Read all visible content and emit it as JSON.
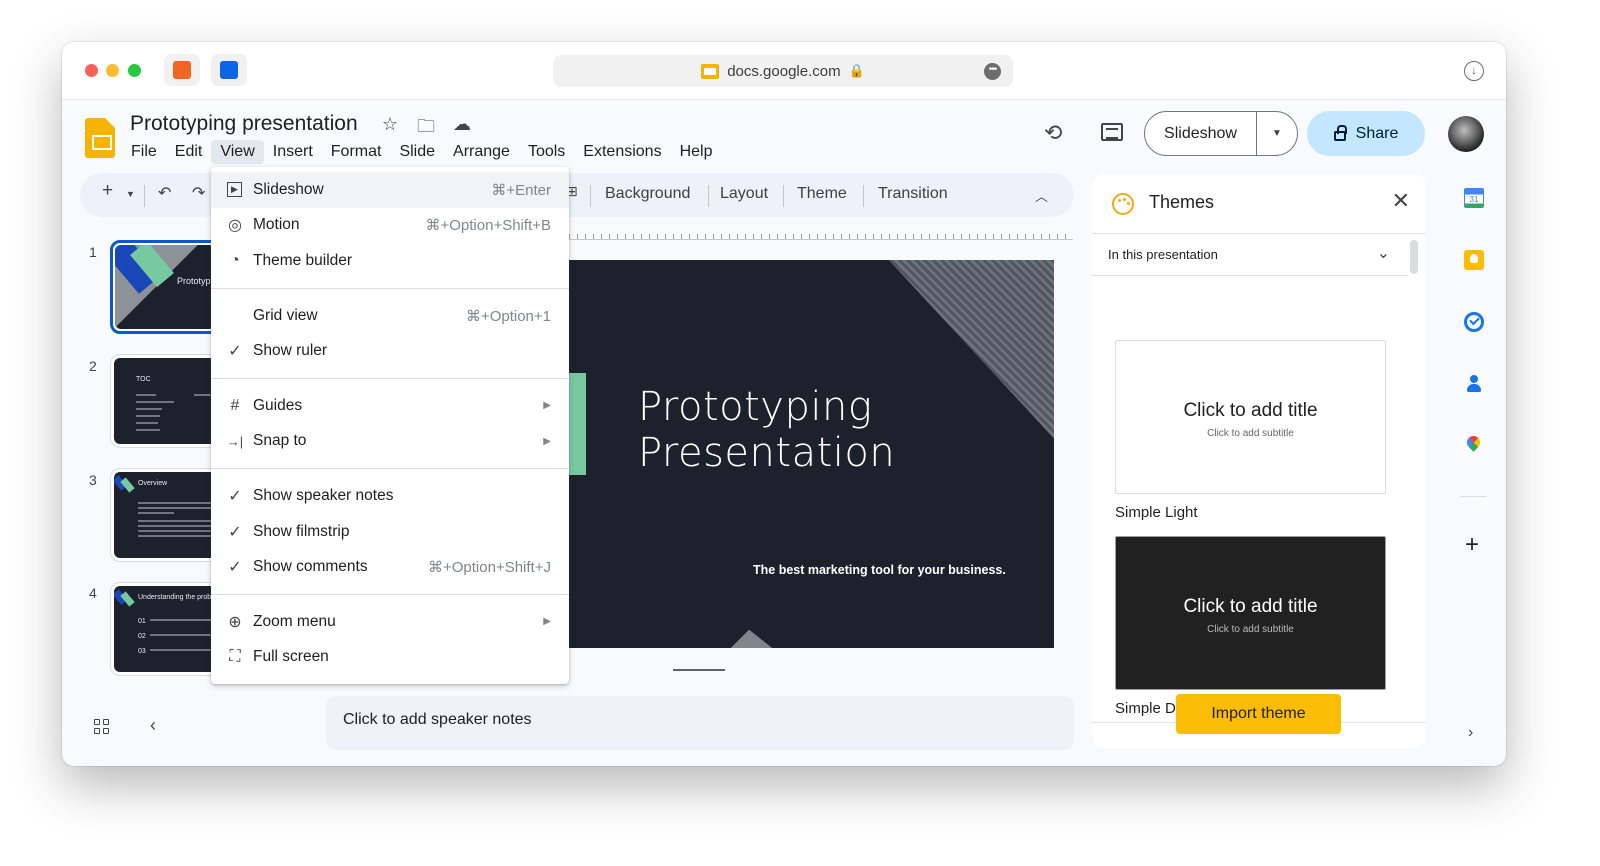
{
  "browser": {
    "url": "docs.google.com",
    "extensions": [
      "html-extension",
      "trello-extension"
    ]
  },
  "header": {
    "doc_title": "Prototyping presentation",
    "menu": [
      "File",
      "Edit",
      "View",
      "Insert",
      "Format",
      "Slide",
      "Arrange",
      "Tools",
      "Extensions",
      "Help"
    ],
    "active_menu": "View",
    "slideshow_label": "Slideshow",
    "share_label": "Share"
  },
  "toolbar": {
    "items": [
      "Background",
      "Layout",
      "Theme",
      "Transition"
    ]
  },
  "view_menu": {
    "groups": [
      [
        {
          "icon": "play-box-icon",
          "glyph": "▶",
          "label": "Slideshow",
          "shortcut": "⌘+Enter",
          "hover": true
        },
        {
          "icon": "motion-icon",
          "glyph": "◎",
          "label": "Motion",
          "shortcut": "⌘+Option+Shift+B"
        },
        {
          "icon": "palette-icon",
          "glyph": "🎨",
          "label": "Theme builder",
          "shortcut": ""
        }
      ],
      [
        {
          "icon": "",
          "glyph": "",
          "label": "Grid view",
          "shortcut": "⌘+Option+1"
        },
        {
          "icon": "check-icon",
          "glyph": "✓",
          "label": "Show ruler",
          "shortcut": ""
        }
      ],
      [
        {
          "icon": "guides-icon",
          "glyph": "#",
          "label": "Guides",
          "submenu": true
        },
        {
          "icon": "snap-icon",
          "glyph": "→|",
          "label": "Snap to",
          "submenu": true
        }
      ],
      [
        {
          "icon": "check-icon",
          "glyph": "✓",
          "label": "Show speaker notes",
          "shortcut": ""
        },
        {
          "icon": "check-icon",
          "glyph": "✓",
          "label": "Show filmstrip",
          "shortcut": ""
        },
        {
          "icon": "check-icon",
          "glyph": "✓",
          "label": "Show comments",
          "shortcut": "⌘+Option+Shift+J"
        }
      ],
      [
        {
          "icon": "zoom-icon",
          "glyph": "⊕",
          "label": "Zoom menu",
          "submenu": true
        },
        {
          "icon": "fullscreen-icon",
          "glyph": "⛶",
          "label": "Full screen",
          "shortcut": ""
        }
      ]
    ]
  },
  "filmstrip": {
    "slides": [
      {
        "number": "1",
        "title": "Prototyping Presentation",
        "selected": true
      },
      {
        "number": "2",
        "title": "TOC"
      },
      {
        "number": "3",
        "title": "Overview"
      },
      {
        "number": "4",
        "title": "Understanding the problem"
      }
    ]
  },
  "slide": {
    "title_line1": "Prototyping",
    "title_line2": "Presentation",
    "subtitle": "The best marketing tool for your business."
  },
  "notes": {
    "placeholder": "Click to add speaker notes"
  },
  "themes_panel": {
    "title": "Themes",
    "filter": "In this presentation",
    "themes": [
      {
        "name": "Simple Light",
        "title_placeholder": "Click to add title",
        "subtitle_placeholder": "Click to add subtitle"
      },
      {
        "name": "Simple Dark",
        "title_placeholder": "Click to add title",
        "subtitle_placeholder": "Click to add subtitle"
      }
    ],
    "import_label": "Import theme"
  },
  "colors": {
    "brand_yellow": "#f4b400",
    "share_bg": "#c2e7ff",
    "selected_blue": "#0b57d0",
    "import_btn": "#fbbc04",
    "slide_bg": "#1c212c",
    "slide_accent": "#77c9a2"
  }
}
